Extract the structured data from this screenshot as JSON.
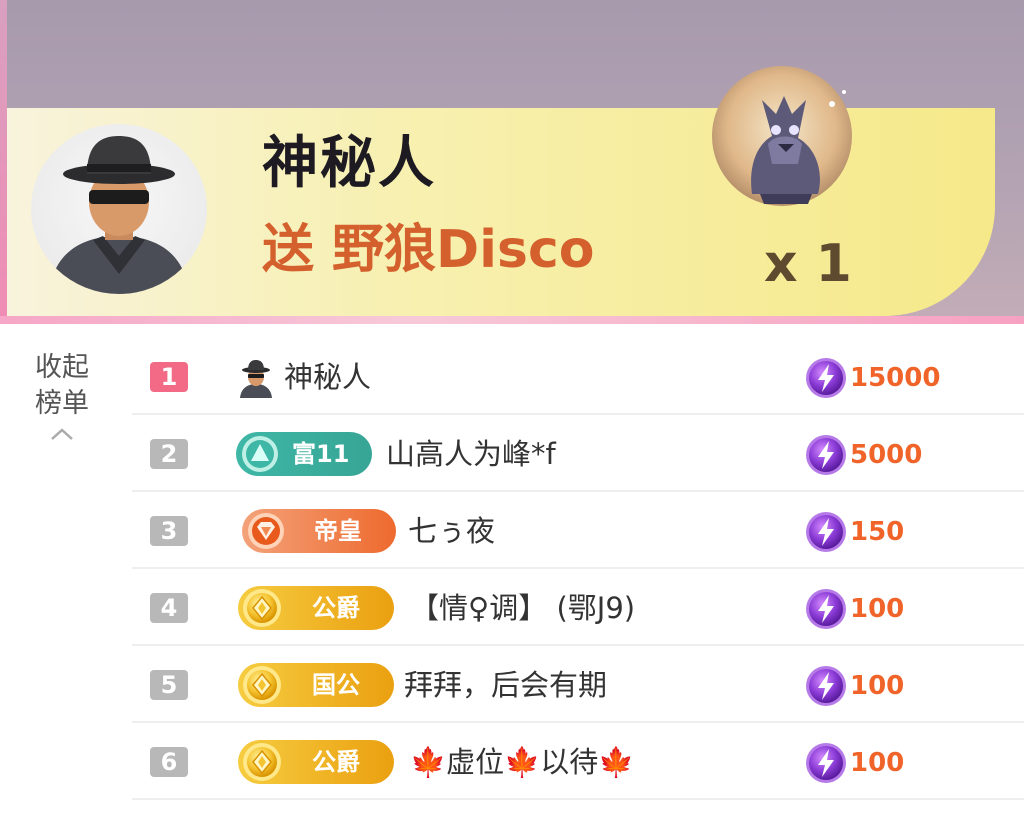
{
  "banner": {
    "sender_name": "神秘人",
    "gift_prefix": "送",
    "gift_name": "野狼Disco",
    "gift_count": "x 1"
  },
  "collapse": {
    "line1": "收起",
    "line2": "榜单"
  },
  "ranking": [
    {
      "rank": "1",
      "level_icon": "mystery-person-avatar",
      "level": "",
      "name": "神秘人",
      "score": "15000"
    },
    {
      "rank": "2",
      "level_icon": "teal-triangle-icon",
      "level": "富11",
      "name": "山高人为峰*f",
      "score": "5000"
    },
    {
      "rank": "3",
      "level_icon": "orange-gem-icon",
      "level": "帝皇",
      "name": "七ぅ夜",
      "score": "150"
    },
    {
      "rank": "4",
      "level_icon": "gold-diamond-icon",
      "level": "公爵",
      "name": "【情♀调】 (鄂J9)",
      "score": "100"
    },
    {
      "rank": "5",
      "level_icon": "gold-diamond-icon",
      "level": "国公",
      "name": "拜拜，后会有期",
      "score": "100"
    },
    {
      "rank": "6",
      "level_icon": "gold-diamond-icon",
      "level": "公爵",
      "name": "🍁虚位🍁以待🍁",
      "score": "100"
    }
  ],
  "colors": {
    "rank_top": "#f26a86",
    "rank_other": "#b8b8b8",
    "score": "#f0642a",
    "gift_text": "#d4602d",
    "coin": "#8b3bd6"
  }
}
